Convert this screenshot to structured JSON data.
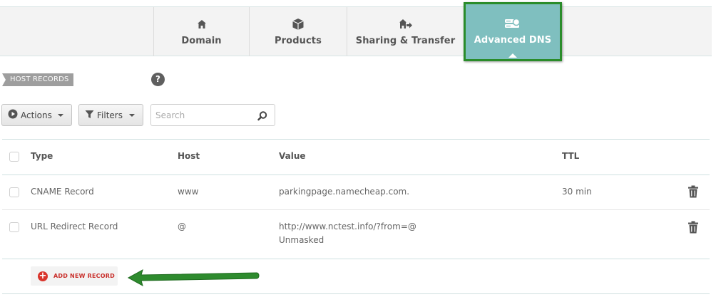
{
  "tabs": [
    {
      "id": "domain",
      "label": "Domain",
      "icon": "home-icon"
    },
    {
      "id": "products",
      "label": "Products",
      "icon": "box-icon"
    },
    {
      "id": "sharing",
      "label": "Sharing & Transfer",
      "icon": "transfer-icon"
    },
    {
      "id": "dns",
      "label": "Advanced DNS",
      "icon": "server-icon",
      "active": true
    }
  ],
  "section": {
    "label": "HOST RECORDS",
    "help": "?"
  },
  "toolbar": {
    "actions_label": "Actions",
    "filters_label": "Filters",
    "search_placeholder": "Search"
  },
  "table": {
    "headers": {
      "type": "Type",
      "host": "Host",
      "value": "Value",
      "ttl": "TTL"
    },
    "rows": [
      {
        "type": "CNAME Record",
        "host": "www",
        "value": "parkingpage.namecheap.com.",
        "value2": "",
        "ttl": "30 min"
      },
      {
        "type": "URL Redirect Record",
        "host": "@",
        "value": "http://www.nctest.info/?from=@",
        "value2": "Unmasked",
        "ttl": ""
      }
    ]
  },
  "add_record": {
    "label": "ADD NEW RECORD"
  },
  "colors": {
    "active_tab": "#7fbfbf",
    "highlight_border": "#2a8c2a",
    "annotation_arrow": "#2e8b2e",
    "add_button_accent": "#d9342b"
  }
}
